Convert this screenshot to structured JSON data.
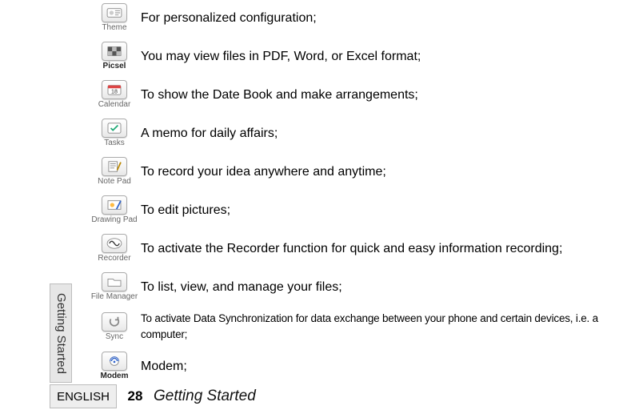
{
  "rows": [
    {
      "icon_key": "theme",
      "icon_label": "Theme",
      "desc": "For personalized configuration;"
    },
    {
      "icon_key": "picsel",
      "icon_label": "Picsel",
      "desc": "You may view files in PDF, Word, or Excel format;"
    },
    {
      "icon_key": "calendar",
      "icon_label": "Calendar",
      "desc": "To show the Date Book and make arrangements;"
    },
    {
      "icon_key": "tasks",
      "icon_label": "Tasks",
      "desc": "A memo for daily affairs;"
    },
    {
      "icon_key": "notepad",
      "icon_label": "Note Pad",
      "desc": "To record your idea anywhere and anytime;"
    },
    {
      "icon_key": "drawingpad",
      "icon_label": "Drawing Pad",
      "desc": "To edit pictures;"
    },
    {
      "icon_key": "recorder",
      "icon_label": "Recorder",
      "desc": "To activate the Recorder function for quick and easy information recording;"
    },
    {
      "icon_key": "filemanager",
      "icon_label": "File Manager",
      "desc": "To list, view, and manage your files;"
    },
    {
      "icon_key": "sync",
      "icon_label": "Sync",
      "desc": "To activate Data Synchronization for data exchange between your phone and certain devices, i.e. a computer;",
      "small": true
    },
    {
      "icon_key": "modem",
      "icon_label": "Modem",
      "desc": "Modem;"
    }
  ],
  "side_tab": "Getting Started",
  "footer": {
    "language": "ENGLISH",
    "page_number": "28",
    "section_title": "Getting Started"
  }
}
